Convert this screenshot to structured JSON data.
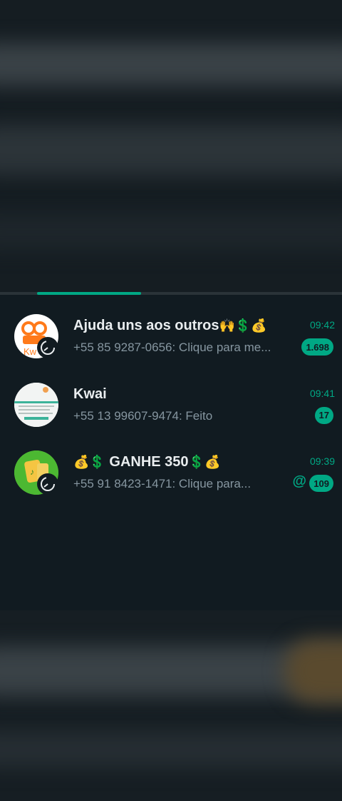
{
  "chats": [
    {
      "name_text": "Ajuda uns aos outros",
      "name_emoji_suffix": "🙌💲💰",
      "preview": "+55 85 9287-0656: Clique para me...",
      "time": "09:42",
      "unread": "1.698",
      "avatar": "kwai-logo-avatar"
    },
    {
      "name_text": "Kwai",
      "preview": "+55 13 99607-9474: Feito",
      "time": "09:41",
      "unread": "17",
      "avatar": "document-screenshot-avatar"
    },
    {
      "name_emoji_prefix": "💰💲",
      "name_text": "GANHE 350",
      "name_emoji_suffix": "💲💰",
      "preview": "+55 91 8423-1471: Clique para...",
      "time": "09:39",
      "unread": "109",
      "mention": "@",
      "avatar": "green-app-avatar"
    }
  ],
  "colors": {
    "accent": "#00a884",
    "background": "#111b21",
    "primary_text": "#e9edef",
    "secondary_text": "#8696a0"
  }
}
